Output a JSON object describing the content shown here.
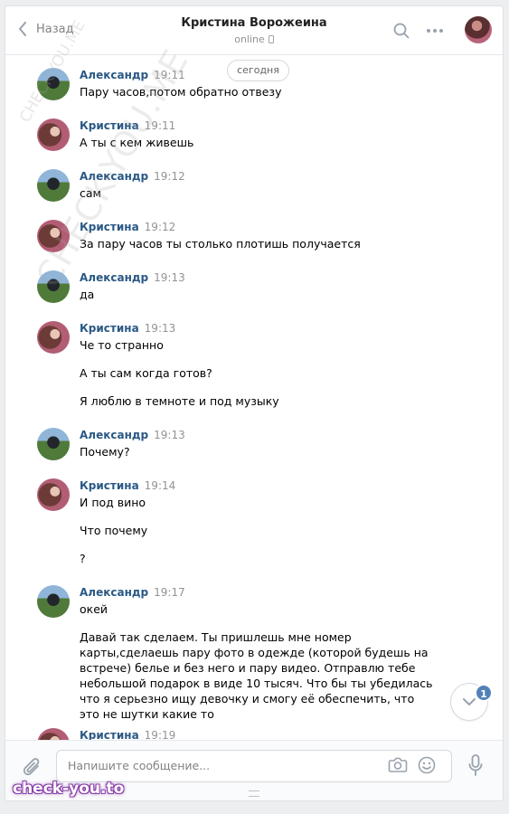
{
  "header": {
    "back_label": "Назад",
    "peer_name": "Кристина Ворожеина",
    "peer_status": "online"
  },
  "date_divider": "сегодня",
  "messages": [
    {
      "author": "Александр",
      "time": "19:11",
      "avatar": "alexander",
      "lines": [
        "Пару часов,потом обратно отвезу"
      ]
    },
    {
      "author": "Кристина",
      "time": "19:11",
      "avatar": "kristina",
      "lines": [
        "А ты с кем живешь"
      ]
    },
    {
      "author": "Александр",
      "time": "19:12",
      "avatar": "alexander",
      "lines": [
        "сам"
      ]
    },
    {
      "author": "Кристина",
      "time": "19:12",
      "avatar": "kristina",
      "lines": [
        "За пару часов ты столько плотишь получается"
      ]
    },
    {
      "author": "Александр",
      "time": "19:13",
      "avatar": "alexander",
      "lines": [
        "да"
      ]
    },
    {
      "author": "Кристина",
      "time": "19:13",
      "avatar": "kristina",
      "lines": [
        "Че то странно",
        "А ты сам когда готов?",
        "Я люблю в темноте и под музыку"
      ]
    },
    {
      "author": "Александр",
      "time": "19:13",
      "avatar": "alexander",
      "lines": [
        "Почему?"
      ]
    },
    {
      "author": "Кристина",
      "time": "19:14",
      "avatar": "kristina",
      "lines": [
        "И под вино",
        "Что почему",
        "?"
      ]
    },
    {
      "author": "Александр",
      "time": "19:17",
      "avatar": "alexander",
      "lines": [
        "окей",
        "Давай так сделаем. Ты пришлешь мне номер карты,сделаешь пару фото в одежде (которой будешь на встрече) белье и без него и пару видео. Отправлю тебе небольшой подарок в виде 10 тысяч. Что бы ты убедилась что я серьезно ищу девочку и смогу её обеспечить, что это не шутки какие то"
      ]
    },
    {
      "author": "Кристина",
      "time": "19:19",
      "avatar": "kristina",
      "lines": []
    }
  ],
  "composer": {
    "placeholder": "Напишите сообщение..."
  },
  "unread_badge": "1",
  "watermarks": {
    "diagonal_large": "CHECK-YOU.ME",
    "diagonal_small": "CHECK-YOU.ME",
    "bottom_logo": "check-you.to"
  },
  "colors": {
    "accent": "#2a5885",
    "badge": "#5181b8",
    "background": "#edeef0"
  },
  "icons": [
    "back-chevron-icon",
    "phone-icon",
    "search-icon",
    "more-icon",
    "attach-icon",
    "camera-icon",
    "emoji-icon",
    "microphone-icon",
    "chevron-down-icon"
  ]
}
